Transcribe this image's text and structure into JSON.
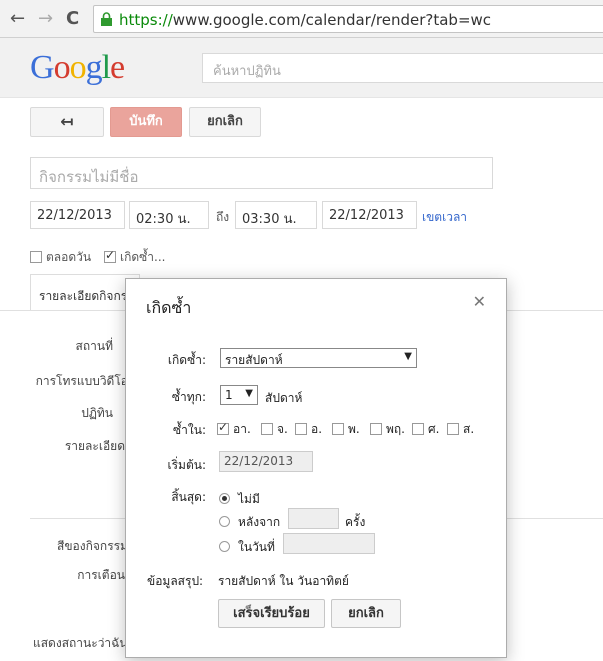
{
  "browser": {
    "back": "←",
    "forward": "→",
    "reload": "C",
    "url_https": "https://",
    "url_rest": "www.google.com/calendar/render?tab=wc"
  },
  "header": {
    "logo": [
      "G",
      "o",
      "o",
      "g",
      "l",
      "e"
    ],
    "search_placeholder": "ค้นหาปฏิทิน"
  },
  "toolbar": {
    "back_label": "↤",
    "save_label": "บันทึก",
    "cancel_label": "ยกเลิก"
  },
  "event": {
    "title_placeholder": "กิจกรรมไม่มีชื่อ",
    "start_date": "22/12/2013",
    "start_time": "02:30 น.",
    "to_label": "ถึง",
    "end_time": "03:30 น.",
    "end_date": "22/12/2013",
    "timezone_link": "เขตเวลา",
    "all_day_label": "ตลอดวัน",
    "repeat_label": "เกิดซ้ำ..."
  },
  "details": {
    "tab_label": "รายละเอียดกิจกรรม",
    "where_label": "สถานที่",
    "video_call_label": "การโทรแบบวิดีโอ",
    "calendar_label": "ปฏิทิน",
    "description_label": "รายละเอียด",
    "event_color_label": "สีของกิจกรรม",
    "notifications_label": "การเตือน",
    "show_me_as_label": "แสดงสถานะว่าฉัน"
  },
  "dialog": {
    "title": "เกิดซ้ำ",
    "close": "✕",
    "repeats_label": "เกิดซ้ำ:",
    "repeats_value": "รายสัปดาห์",
    "every_label": "ซ้ำทุก:",
    "every_value": "1",
    "every_unit": "สัปดาห์",
    "on_label": "ซ้ำใน:",
    "days": [
      {
        "label": "อา.",
        "checked": true
      },
      {
        "label": "จ.",
        "checked": false
      },
      {
        "label": "อ.",
        "checked": false
      },
      {
        "label": "พ.",
        "checked": false
      },
      {
        "label": "พฤ.",
        "checked": false
      },
      {
        "label": "ศ.",
        "checked": false
      },
      {
        "label": "ส.",
        "checked": false
      }
    ],
    "starts_label": "เริ่มต้น:",
    "starts_value": "22/12/2013",
    "ends_label": "สิ้นสุด:",
    "ends_never": "ไม่มี",
    "ends_after": "หลังจาก",
    "ends_after_unit": "ครั้ง",
    "ends_on": "ในวันที่",
    "summary_label": "ข้อมูลสรุป:",
    "summary_value": "รายสัปดาห์ ใน วันอาทิตย์",
    "done_button": "เสร็จเรียบร้อย",
    "cancel_button": "ยกเลิก"
  }
}
